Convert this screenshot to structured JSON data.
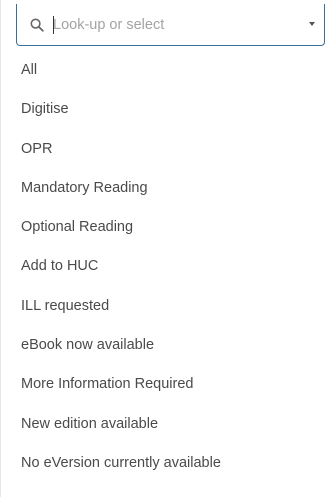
{
  "search": {
    "placeholder": "Look-up or select",
    "value": ""
  },
  "options": [
    "All",
    "Digitise",
    "OPR",
    "Mandatory Reading",
    "Optional Reading",
    "Add to HUC",
    "ILL requested",
    "eBook now available",
    "More Information Required",
    "New edition available",
    "No eVersion currently available"
  ],
  "colors": {
    "border_accent": "#3a6f9a",
    "text": "#4a4a4a",
    "placeholder": "#a3a3a3"
  }
}
